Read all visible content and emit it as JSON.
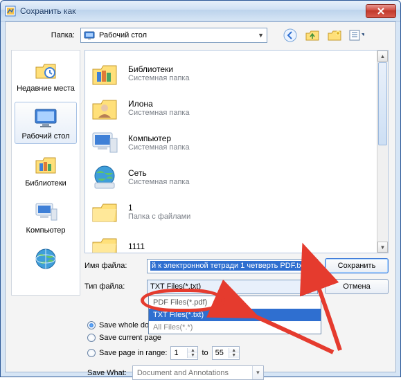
{
  "title": "Сохранить как",
  "toprow": {
    "label": "Папка:",
    "folder": "Рабочий стол"
  },
  "places": [
    {
      "key": "recent",
      "label": "Недавние места"
    },
    {
      "key": "desktop",
      "label": "Рабочий стол"
    },
    {
      "key": "libraries",
      "label": "Библиотеки"
    },
    {
      "key": "computer",
      "label": "Компьютер"
    },
    {
      "key": "network",
      "label": ""
    }
  ],
  "files": [
    {
      "name": "Библиотеки",
      "sub": "Системная папка",
      "icon": "libraries"
    },
    {
      "name": "Илона",
      "sub": "Системная папка",
      "icon": "user"
    },
    {
      "name": "Компьютер",
      "sub": "Системная папка",
      "icon": "computer"
    },
    {
      "name": "Сеть",
      "sub": "Системная папка",
      "icon": "network"
    },
    {
      "name": "1",
      "sub": "Папка с файлами",
      "icon": "folder"
    },
    {
      "name": "1111",
      "sub": "",
      "icon": "folder"
    }
  ],
  "form": {
    "namelabel": "Имя файла:",
    "typelabel": "Тип файла:",
    "filename": "й к электронной тетради 1 четверть PDF.txt",
    "typevalue": "TXT Files(*.txt)",
    "savebtn": "Сохранить",
    "cancelbtn": "Отмена"
  },
  "droplist": {
    "top_partial": "PDF Files(*.pdf)",
    "highlighted": "TXT Files(*.txt)",
    "bottom_partial": "All Files(*.*)"
  },
  "opts": {
    "r1": "Save whole document",
    "r2": "Save current page",
    "r3": "Save page in range:",
    "from": "1",
    "to_label": "to",
    "to": "55",
    "savewhat_label": "Save What:",
    "savewhat_value": "Document and Annotations"
  }
}
